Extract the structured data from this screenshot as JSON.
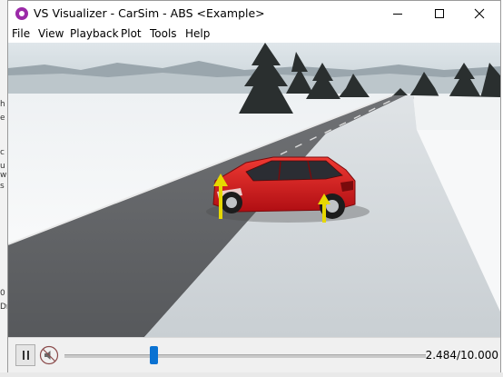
{
  "window": {
    "title": "VS Visualizer - CarSim - ABS <Example>"
  },
  "menu": {
    "items": [
      "File",
      "View",
      "Playback",
      "Plot",
      "Tools",
      "Help"
    ]
  },
  "background_app": {
    "edge_chars": [
      "h",
      "e",
      "c",
      "u",
      "w",
      "s",
      "0",
      "Dr"
    ]
  },
  "playback": {
    "time_readout": "2.484/10.000",
    "progress_fraction": 0.2484
  },
  "colors": {
    "car_body": "#d0141a",
    "force_arrow": "#e6d800",
    "slider_thumb": "#0a72d2",
    "app_icon": "#9b2aa8"
  }
}
